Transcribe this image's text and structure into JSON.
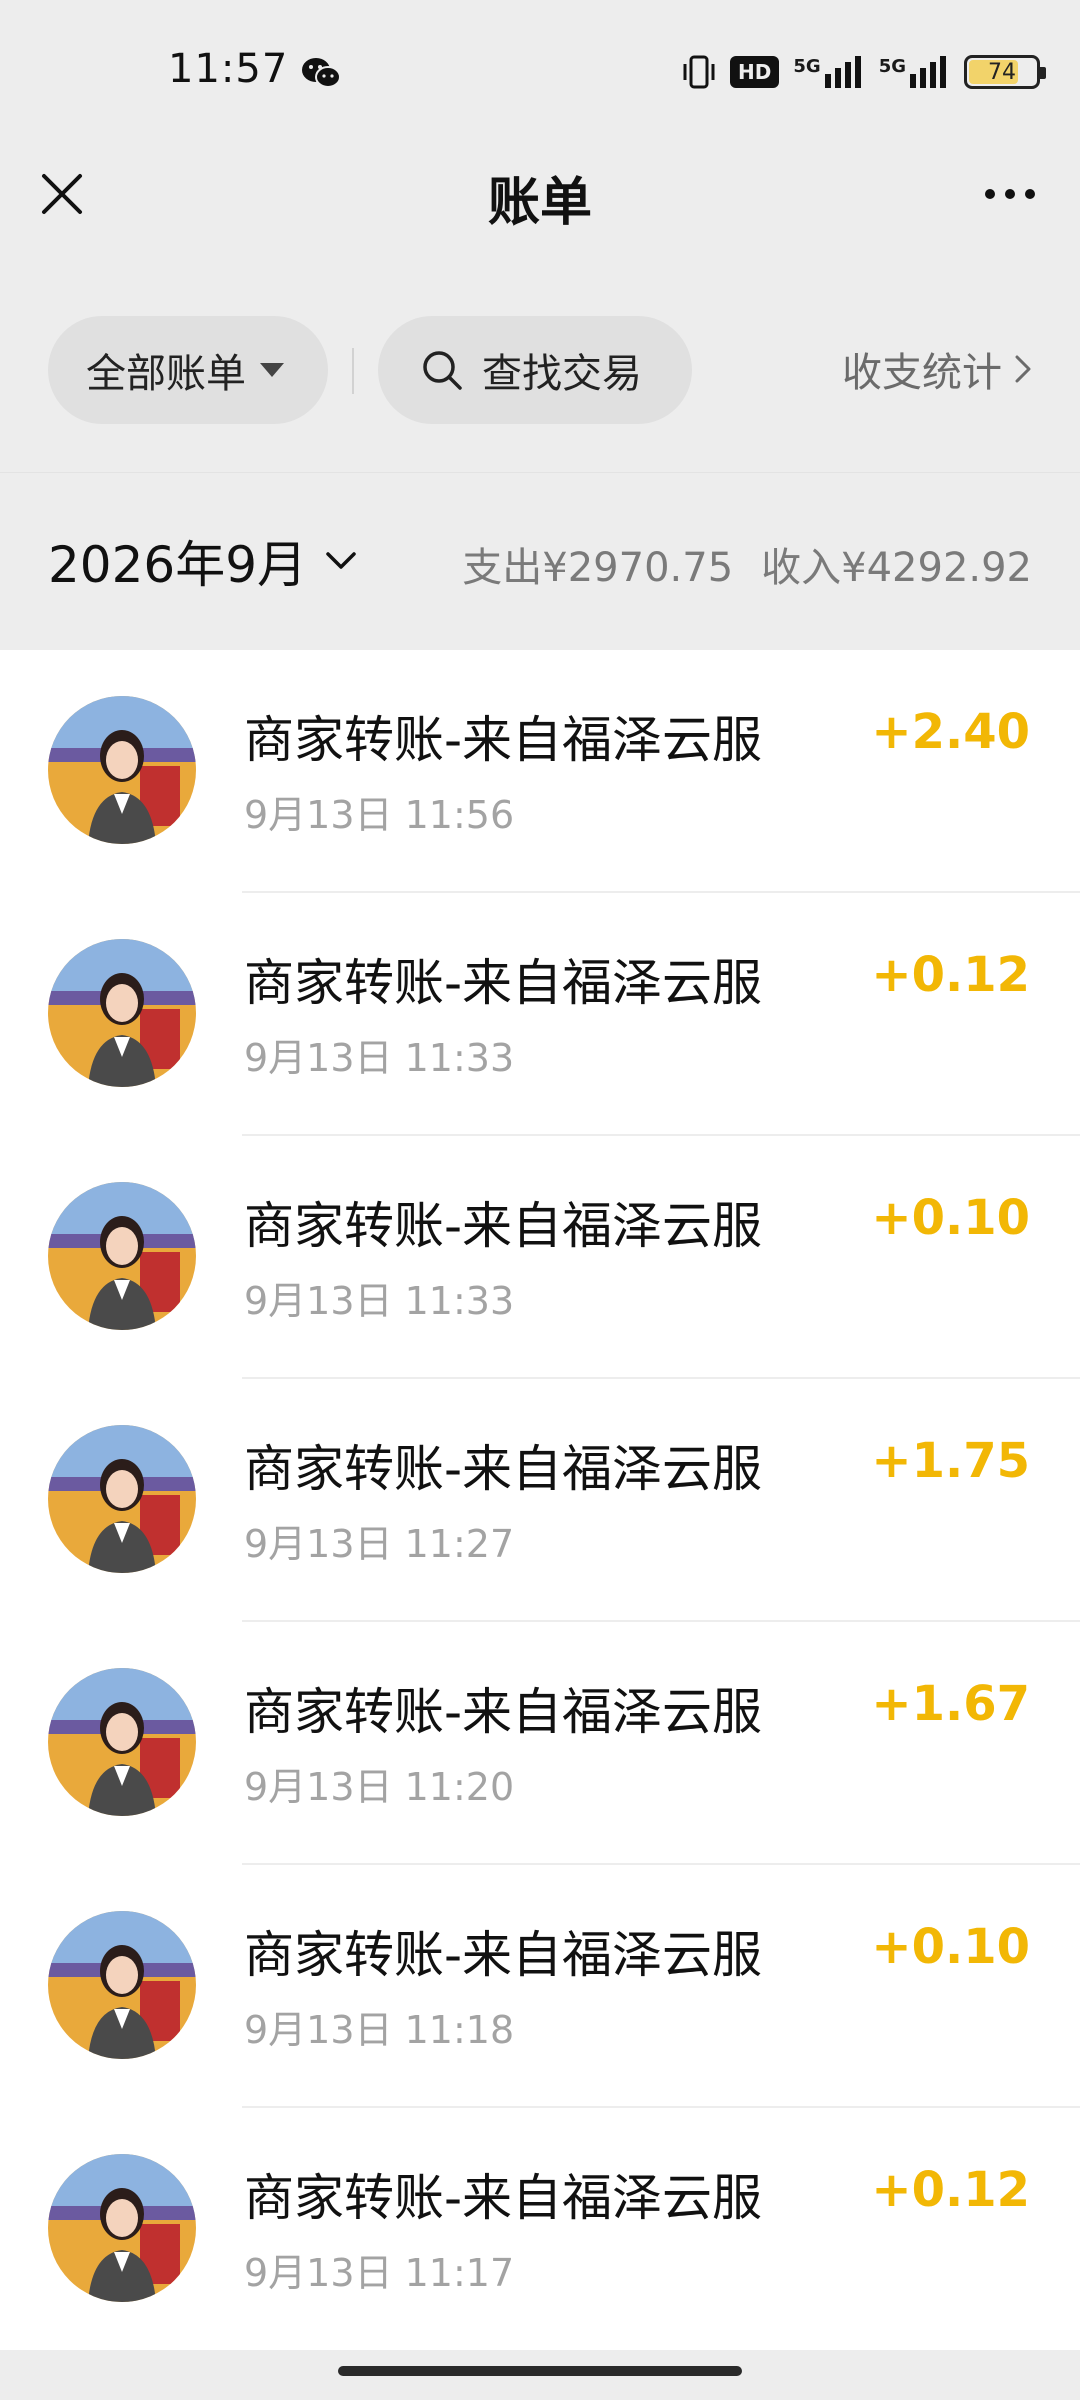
{
  "status_bar": {
    "time": "11:57",
    "network_hd": "HD",
    "network_5g_1": "5G",
    "network_5g_2": "5G",
    "battery": "74"
  },
  "header": {
    "title": "账单",
    "close_icon": "close-icon",
    "more_icon": "more-icon"
  },
  "filters": {
    "all_bills": "全部账单",
    "search": "查找交易",
    "stats": "收支统计"
  },
  "month": {
    "label": "2026年9月",
    "expense_label": "支出",
    "expense_amount": "¥2970.75",
    "income_label": "收入",
    "income_amount": "¥4292.92"
  },
  "transactions": [
    {
      "title": "商家转账-来自福泽云服",
      "time": "9月13日 11:56",
      "amount": "+2.40"
    },
    {
      "title": "商家转账-来自福泽云服",
      "time": "9月13日 11:33",
      "amount": "+0.12"
    },
    {
      "title": "商家转账-来自福泽云服",
      "time": "9月13日 11:33",
      "amount": "+0.10"
    },
    {
      "title": "商家转账-来自福泽云服",
      "time": "9月13日 11:27",
      "amount": "+1.75"
    },
    {
      "title": "商家转账-来自福泽云服",
      "time": "9月13日 11:20",
      "amount": "+1.67"
    },
    {
      "title": "商家转账-来自福泽云服",
      "time": "9月13日 11:18",
      "amount": "+0.10"
    },
    {
      "title": "商家转账-来自福泽云服",
      "time": "9月13日 11:17",
      "amount": "+0.12"
    }
  ],
  "colors": {
    "income_amount": "#f2b705",
    "background": "#ededed",
    "list_bg": "#ffffff"
  }
}
